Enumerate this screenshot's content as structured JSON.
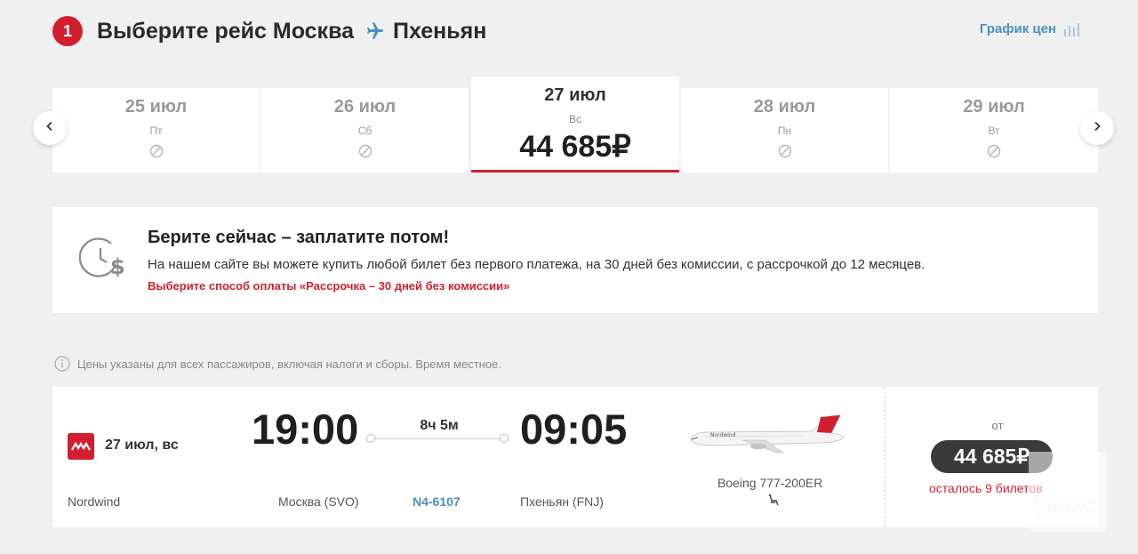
{
  "header": {
    "step_number": "1",
    "title_prefix": "Выберите рейс",
    "origin": "Москва",
    "destination": "Пхеньян",
    "price_chart_label": "График цен"
  },
  "dates": [
    {
      "date": "25 июл",
      "weekday": "Пт",
      "available": false
    },
    {
      "date": "26 июл",
      "weekday": "Сб",
      "available": false
    },
    {
      "date": "27 июл",
      "weekday": "Вс",
      "price": "44 685₽",
      "available": true,
      "selected": true
    },
    {
      "date": "28 июл",
      "weekday": "Пн",
      "available": false
    },
    {
      "date": "29 июл",
      "weekday": "Вт",
      "available": false
    }
  ],
  "promo": {
    "title": "Берите сейчас – заплатите потом!",
    "text": "На нашем сайте вы можете купить любой билет без первого платежа, на 30 дней без комиссии, с рассрочкой до 12 месяцев.",
    "link": "Выберите способ оплаты «Рассрочка – 30 дней без комиссии»"
  },
  "notice": "Цены указаны для всех пассажиров, включая налоги и сборы. Время местное.",
  "flight": {
    "date": "27 июл, вс",
    "airline": "Nordwind",
    "departure_time": "19:00",
    "arrival_time": "09:05",
    "duration": "8ч 5м",
    "departure_airport": "Москва (SVO)",
    "arrival_airport": "Пхеньян (FNJ)",
    "flight_number": "N4-6107",
    "aircraft": "Boeing 777-200ER",
    "price_prefix": "от",
    "price": "44 685₽",
    "seats_left": "осталось 9 билетов"
  },
  "watermark": "ТАСС",
  "colors": {
    "accent_red": "#d21f2f",
    "link_blue": "#4a8fc2",
    "background": "#f0f0f0"
  }
}
